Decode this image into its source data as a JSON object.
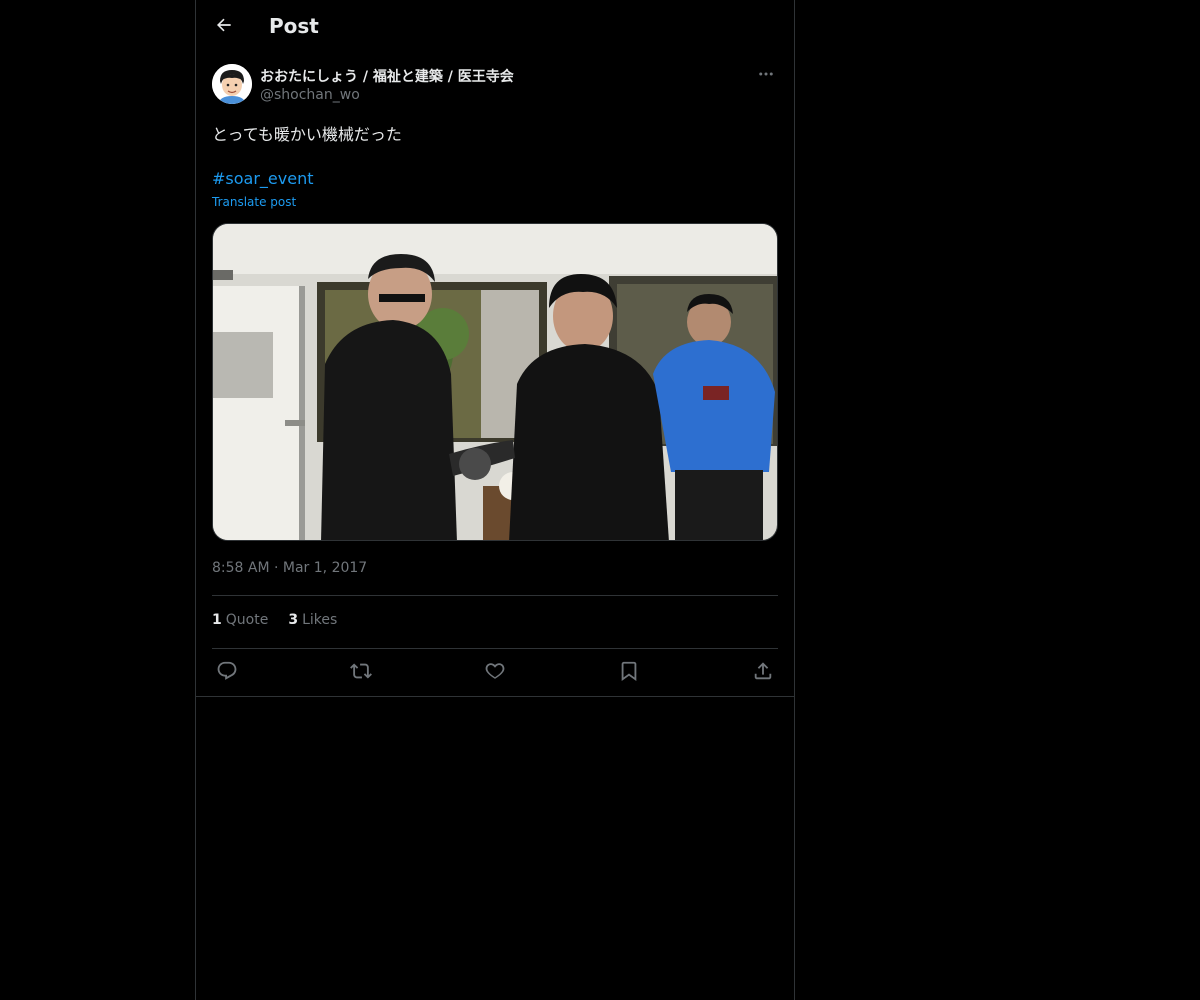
{
  "header": {
    "title": "Post"
  },
  "tweet": {
    "author": {
      "display_name": "おおたにしょう / 福祉と建築 / 医王寺会",
      "handle": "@shochan_wo"
    },
    "text": "とっても暖かい機械だった",
    "hashtag": "#soar_event",
    "translate_label": "Translate post",
    "timestamp": "8:58 AM · Mar 1, 2017",
    "stats": {
      "quotes": "1",
      "quotes_label": "Quote",
      "likes": "3",
      "likes_label": "Likes"
    }
  },
  "colors": {
    "accent": "#1d9bf0",
    "background": "#000000",
    "text": "#e7e9ea",
    "secondary": "#71767b",
    "border": "#2f3336"
  },
  "icons": [
    "back-arrow-icon",
    "more-icon",
    "reply-icon",
    "retweet-icon",
    "like-icon",
    "bookmark-icon",
    "share-icon"
  ]
}
